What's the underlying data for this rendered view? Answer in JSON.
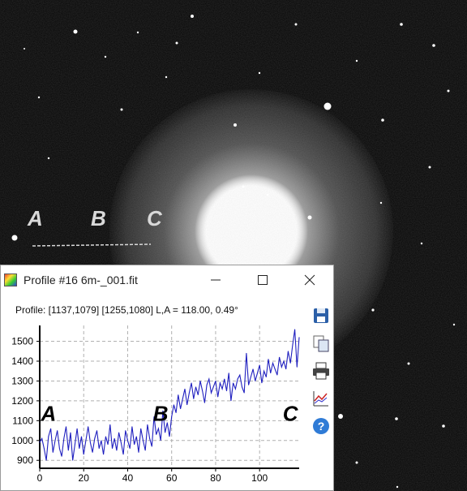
{
  "overlay_letters": [
    "A",
    "B",
    "C"
  ],
  "window": {
    "title": "Profile #16 6m-_001.fit",
    "profile_info": "Profile: [1137,1079] [1255,1080] L,A = 118.00, 0.49°"
  },
  "toolbar": {
    "icons": [
      "save-icon",
      "copy-icon",
      "print-icon",
      "chart-icon",
      "help-icon"
    ]
  },
  "colors": {
    "series": "#1f1fbf",
    "grid": "#b0b0b0",
    "sky_overlay": "#d9d9d9"
  },
  "chart_data": {
    "type": "line",
    "title": "",
    "xlabel": "",
    "ylabel": "",
    "xlim": [
      0,
      118
    ],
    "ylim": [
      860,
      1580
    ],
    "x_ticks": [
      0,
      20,
      40,
      60,
      80,
      100
    ],
    "y_ticks": [
      900,
      1000,
      1100,
      1200,
      1300,
      1400,
      1500
    ],
    "grid": true,
    "annotations": [
      {
        "text": "A",
        "x": 4
      },
      {
        "text": "B",
        "x": 55
      },
      {
        "text": "C",
        "x": 114
      }
    ],
    "series": [
      {
        "name": "",
        "x": [
          0,
          1,
          2,
          3,
          4,
          5,
          6,
          7,
          8,
          9,
          10,
          11,
          12,
          13,
          14,
          15,
          16,
          17,
          18,
          19,
          20,
          21,
          22,
          23,
          24,
          25,
          26,
          27,
          28,
          29,
          30,
          31,
          32,
          33,
          34,
          35,
          36,
          37,
          38,
          39,
          40,
          41,
          42,
          43,
          44,
          45,
          46,
          47,
          48,
          49,
          50,
          51,
          52,
          53,
          54,
          55,
          56,
          57,
          58,
          59,
          60,
          61,
          62,
          63,
          64,
          65,
          66,
          67,
          68,
          69,
          70,
          71,
          72,
          73,
          74,
          75,
          76,
          77,
          78,
          79,
          80,
          81,
          82,
          83,
          84,
          85,
          86,
          87,
          88,
          89,
          90,
          91,
          92,
          93,
          94,
          95,
          96,
          97,
          98,
          99,
          100,
          101,
          102,
          103,
          104,
          105,
          106,
          107,
          108,
          109,
          110,
          111,
          112,
          113,
          114,
          115,
          116,
          117,
          118
        ],
        "values": [
          990,
          1010,
          960,
          900,
          1020,
          1060,
          940,
          1000,
          1050,
          960,
          920,
          1010,
          1070,
          950,
          1040,
          900,
          980,
          1060,
          960,
          1020,
          930,
          1000,
          1070,
          990,
          940,
          1010,
          1050,
          960,
          1000,
          930,
          1020,
          980,
          1080,
          960,
          1010,
          950,
          1040,
          990,
          930,
          1050,
          1000,
          960,
          1070,
          980,
          1020,
          940,
          1060,
          1000,
          950,
          1080,
          1010,
          970,
          1120,
          1030,
          1060,
          1000,
          1150,
          1040,
          1090,
          1020,
          1120,
          1180,
          1140,
          1230,
          1160,
          1210,
          1260,
          1180,
          1240,
          1290,
          1210,
          1270,
          1230,
          1300,
          1250,
          1190,
          1280,
          1310,
          1240,
          1270,
          1300,
          1220,
          1290,
          1260,
          1310,
          1250,
          1340,
          1200,
          1290,
          1260,
          1310,
          1330,
          1270,
          1240,
          1440,
          1280,
          1320,
          1360,
          1300,
          1340,
          1380,
          1290,
          1350,
          1320,
          1410,
          1340,
          1390,
          1360,
          1330,
          1420,
          1370,
          1400,
          1360,
          1450,
          1390,
          1480,
          1560,
          1370,
          1520
        ]
      }
    ]
  }
}
